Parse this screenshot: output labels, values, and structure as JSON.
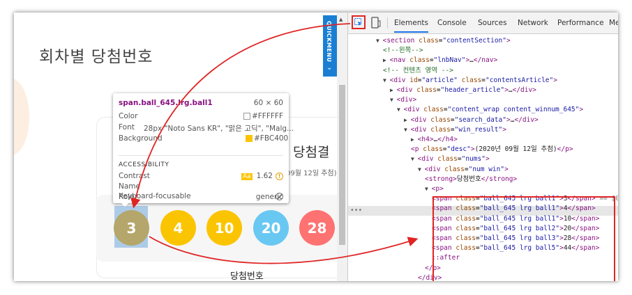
{
  "page": {
    "title": "회차별 당첨번호",
    "result_title": "당첨결",
    "desc": "09월 12일 추첨)",
    "win_label": "당첨번호",
    "quick_menu": "QUICKMENU",
    "balls": [
      "3",
      "4",
      "10",
      "20",
      "28"
    ]
  },
  "tooltip": {
    "selector": "span.ball_645.lrg.ball1",
    "size": "60 × 60",
    "color_label": "Color",
    "color_value": "#FFFFFF",
    "font_label": "Font",
    "font_value": "28px \"Noto Sans KR\", \"맑은 고딕\", \"Malg...",
    "background_label": "Background",
    "background_value": "#FBC400",
    "accessibility": "ACCESSIBILITY",
    "contrast_label": "Contrast",
    "contrast_aa": "Aa",
    "contrast_value": "1.62",
    "name_label": "Name",
    "role_label": "Role",
    "role_value": "generic",
    "keyboard_label": "Keyboard-focusable"
  },
  "devtools": {
    "tabs": [
      "Elements",
      "Console",
      "Sources",
      "Network",
      "Performance",
      "Mer"
    ],
    "lines": [
      {
        "indent": 1,
        "tri": "▼",
        "html": "<span class='t'>&lt;section</span> <span class='a'>class</span>=<span class='v'>\"contentSection\"</span><span class='t'>&gt;</span>"
      },
      {
        "indent": 2,
        "tri": "",
        "html": "<span class='c'>&lt;!--왼쪽--&gt;</span>"
      },
      {
        "indent": 2,
        "tri": "▶",
        "html": "<span class='t'>&lt;nav</span> <span class='a'>class</span>=<span class='v'>\"lnbNav\"</span><span class='t'>&gt;</span>…<span class='t'>&lt;/nav&gt;</span>"
      },
      {
        "indent": 2,
        "tri": "",
        "html": "<span class='c'>&lt;!-- 컨텐츠 영역 --&gt;</span>"
      },
      {
        "indent": 2,
        "tri": "▼",
        "html": "<span class='t'>&lt;div</span> <span class='a'>id</span>=<span class='v'>\"article\"</span> <span class='a'>class</span>=<span class='v'>\"contentsArticle\"</span><span class='t'>&gt;</span>"
      },
      {
        "indent": 3,
        "tri": "▶",
        "html": "<span class='t'>&lt;div</span> <span class='a'>class</span>=<span class='v'>\"header_article\"</span><span class='t'>&gt;</span>…<span class='t'>&lt;/div&gt;</span>"
      },
      {
        "indent": 3,
        "tri": "▼",
        "html": "<span class='t'>&lt;div&gt;</span>"
      },
      {
        "indent": 4,
        "tri": "▼",
        "html": "<span class='t'>&lt;div</span> <span class='a'>class</span>=<span class='v'>\"content_wrap content_winnum_645\"</span><span class='t'>&gt;</span>"
      },
      {
        "indent": 5,
        "tri": "▶",
        "html": "<span class='t'>&lt;div</span> <span class='a'>class</span>=<span class='v'>\"search_data\"</span><span class='t'>&gt;</span>…<span class='t'>&lt;/div&gt;</span>"
      },
      {
        "indent": 5,
        "tri": "▼",
        "html": "<span class='t'>&lt;div</span> <span class='a'>class</span>=<span class='v'>\"win_result\"</span><span class='t'>&gt;</span>"
      },
      {
        "indent": 6,
        "tri": "▶",
        "html": "<span class='t'>&lt;h4&gt;</span>…<span class='t'>&lt;/h4&gt;</span>"
      },
      {
        "indent": 6,
        "tri": "",
        "html": "<span class='t'>&lt;p</span> <span class='a'>class</span>=<span class='v'>\"desc\"</span><span class='t'>&gt;</span><span class='x'>(2020년 09월 12일 추첨)</span><span class='t'>&lt;/p&gt;</span>"
      },
      {
        "indent": 6,
        "tri": "▼",
        "html": "<span class='t'>&lt;div</span> <span class='a'>class</span>=<span class='v'>\"nums\"</span><span class='t'>&gt;</span>"
      },
      {
        "indent": 7,
        "tri": "▼",
        "html": "<span class='t'>&lt;div</span> <span class='a'>class</span>=<span class='v'>\"num win\"</span><span class='t'>&gt;</span>"
      },
      {
        "indent": 8,
        "tri": "",
        "html": "<span class='t'>&lt;strong&gt;</span><span class='x'>당첨번호</span><span class='t'>&lt;/strong&gt;</span>"
      },
      {
        "indent": 8,
        "tri": "▼",
        "html": "<span class='t'>&lt;p&gt;</span>"
      },
      {
        "indent": 9,
        "tri": "",
        "html": "<span class='t'>&lt;span</span> <span class='a'>class</span>=<span class='v'>\"ball_645 lrg ball1\"</span><span class='t'>&gt;</span><span class='x'>3</span><span class='t'>&lt;/span&gt;</span> <span class='g'>== $0</span>"
      },
      {
        "indent": 9,
        "tri": "",
        "html": "<span class='t'>&lt;span</span> <span class='a'>class</span>=<span class='v'>\"ball_645 lrg ball1\"</span><span class='t'>&gt;</span><span class='x'>4</span><span class='t'>&lt;/span&gt;</span>"
      },
      {
        "indent": 9,
        "tri": "",
        "html": "<span class='t'>&lt;span</span> <span class='a'>class</span>=<span class='v'>\"ball_645 lrg ball1\"</span><span class='t'>&gt;</span><span class='x'>10</span><span class='t'>&lt;/span&gt;</span>"
      },
      {
        "indent": 9,
        "tri": "",
        "html": "<span class='t'>&lt;span</span> <span class='a'>class</span>=<span class='v'>\"ball_645 lrg ball2\"</span><span class='t'>&gt;</span><span class='x'>20</span><span class='t'>&lt;/span&gt;</span>"
      },
      {
        "indent": 9,
        "tri": "",
        "html": "<span class='t'>&lt;span</span> <span class='a'>class</span>=<span class='v'>\"ball_645 lrg ball3\"</span><span class='t'>&gt;</span><span class='x'>28</span><span class='t'>&lt;/span&gt;</span>"
      },
      {
        "indent": 9,
        "tri": "",
        "html": "<span class='t'>&lt;span</span> <span class='a'>class</span>=<span class='v'>\"ball_645 lrg ball5\"</span><span class='t'>&gt;</span><span class='x'>44</span><span class='t'>&lt;/span&gt;</span>"
      },
      {
        "indent": 9,
        "tri": "",
        "html": "<span class='t'>::after</span>"
      },
      {
        "indent": 8,
        "tri": "",
        "html": "<span class='t'>&lt;/p&gt;</span>"
      },
      {
        "indent": 7,
        "tri": "",
        "html": "<span class='t'>&lt;/div&gt;</span>"
      }
    ],
    "dots": "•••"
  },
  "colors": {
    "ball1": "#FBC400",
    "ball2": "#69C8F2",
    "ball3": "#FF7272",
    "highlight_red": "#E02424",
    "quickmenu": "#1A7FD3"
  }
}
